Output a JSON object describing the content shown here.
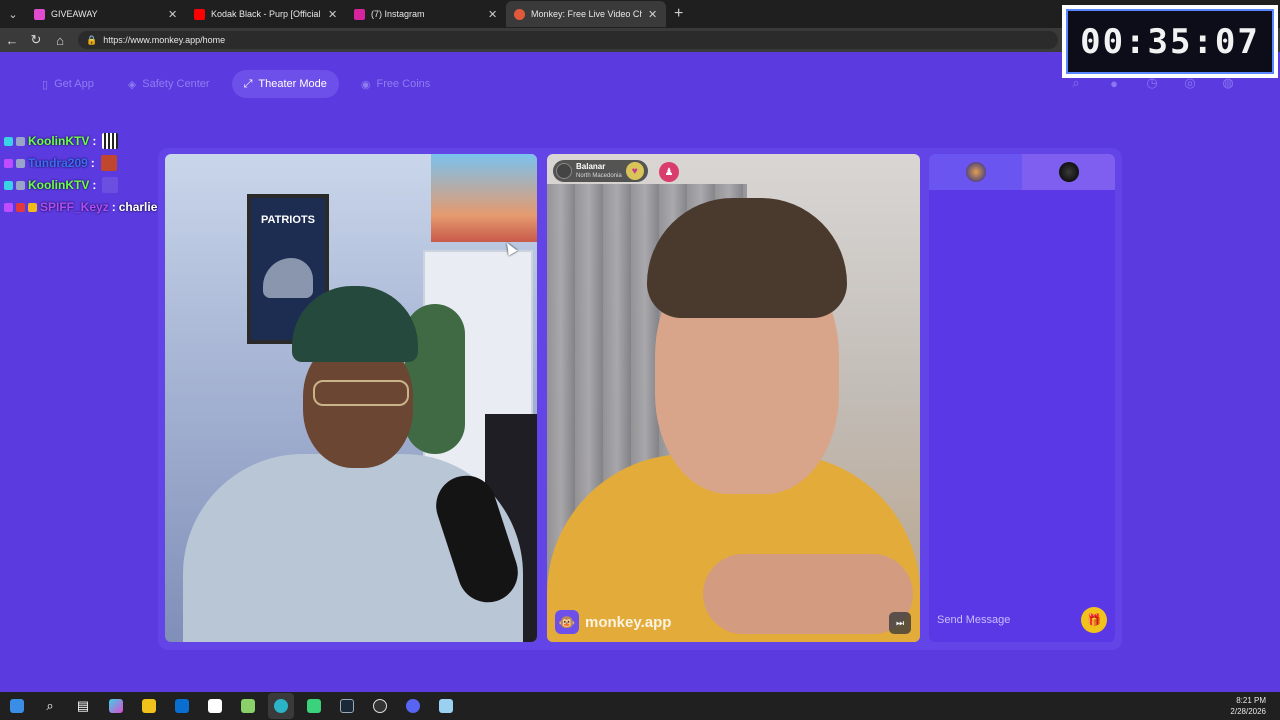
{
  "browser": {
    "tabs": [
      {
        "title": "GIVEAWAY",
        "color": "#e04bd0",
        "active": false
      },
      {
        "title": "Kodak Black - Purp [Official Audio]",
        "color": "#ff0000",
        "active": false
      },
      {
        "title": "(7) Instagram",
        "color": "#d6249f",
        "active": false
      },
      {
        "title": "Monkey: Free Live Video Chat",
        "color": "#e0593a",
        "active": true
      }
    ],
    "url": "https://www.monkey.app/home"
  },
  "timer": "00:35:07",
  "site_nav": {
    "get_app": "Get App",
    "safety_center": "Safety Center",
    "theater_mode": "Theater Mode",
    "free_coins": "Free Coins"
  },
  "chat": [
    {
      "user": "KoolinKTV",
      "color": "#6cff4a",
      "message": ""
    },
    {
      "user": "Tundra209",
      "color": "#3a6cff",
      "message": ""
    },
    {
      "user": "KoolinKTV",
      "color": "#6cff4a",
      "message": ""
    },
    {
      "user": "SPIFF_Keyz",
      "color": "#b04cff",
      "message": "charlie bit my finger kirk"
    }
  ],
  "remote_user": {
    "name": "Balanar",
    "country": "North Macedonia"
  },
  "watermark": "monkey.app",
  "message_placeholder": "Send Message",
  "clock": {
    "time": "8:21 PM",
    "date": "2/28/2026"
  }
}
